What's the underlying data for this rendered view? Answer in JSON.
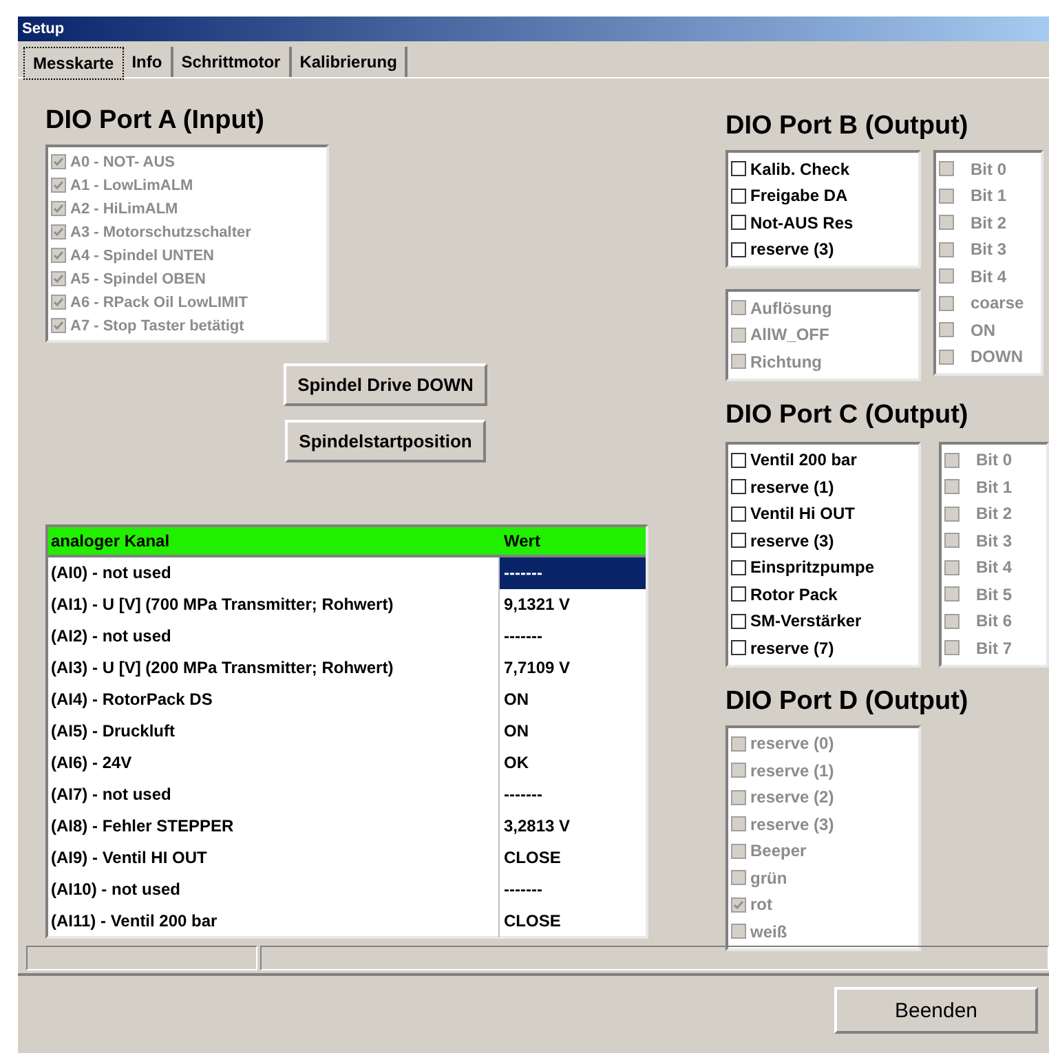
{
  "window": {
    "title": "Setup"
  },
  "tabs": [
    {
      "label": "Messkarte",
      "selected": true
    },
    {
      "label": "Info",
      "selected": false
    },
    {
      "label": "Schrittmotor",
      "selected": false
    },
    {
      "label": "Kalibrierung",
      "selected": false
    }
  ],
  "port_a": {
    "title": "DIO Port A (Input)",
    "items": [
      {
        "label": "A0 - NOT- AUS",
        "checked": true,
        "disabled": true
      },
      {
        "label": "A1 - LowLimALM",
        "checked": true,
        "disabled": true
      },
      {
        "label": "A2 - HiLimALM",
        "checked": true,
        "disabled": true
      },
      {
        "label": "A3 - Motorschutzschalter",
        "checked": true,
        "disabled": true
      },
      {
        "label": "A4 - Spindel UNTEN",
        "checked": true,
        "disabled": true
      },
      {
        "label": "A5 - Spindel OBEN",
        "checked": true,
        "disabled": true
      },
      {
        "label": "A6 - RPack Oil LowLIMIT",
        "checked": true,
        "disabled": true
      },
      {
        "label": "A7 - Stop Taster betätigt",
        "checked": true,
        "disabled": true
      }
    ]
  },
  "buttons": [
    "Spindel Drive DOWN",
    "Spindelstartposition"
  ],
  "table": {
    "columns": [
      "analoger Kanal",
      "Wert"
    ],
    "rows": [
      {
        "cells": [
          "(AI0) - not used",
          "-------"
        ],
        "selected": true
      },
      {
        "cells": [
          "(AI1) - U [V] (700 MPa Transmitter; Rohwert)",
          "9,1321 V"
        ],
        "selected": false
      },
      {
        "cells": [
          "(AI2) - not used",
          "-------"
        ],
        "selected": false
      },
      {
        "cells": [
          "(AI3) - U [V] (200 MPa Transmitter; Rohwert)",
          "7,7109 V"
        ],
        "selected": false
      },
      {
        "cells": [
          "(AI4) - RotorPack DS",
          "ON"
        ],
        "selected": false
      },
      {
        "cells": [
          "(AI5) - Druckluft",
          "ON"
        ],
        "selected": false
      },
      {
        "cells": [
          "(AI6) - 24V",
          "OK"
        ],
        "selected": false
      },
      {
        "cells": [
          "(AI7) - not used",
          "-------"
        ],
        "selected": false
      },
      {
        "cells": [
          "(AI8) - Fehler STEPPER",
          "3,2813 V"
        ],
        "selected": false
      },
      {
        "cells": [
          "(AI9) - Ventil HI OUT",
          "CLOSE"
        ],
        "selected": false
      },
      {
        "cells": [
          "(AI10) - not used",
          "-------"
        ],
        "selected": false
      },
      {
        "cells": [
          "(AI11) - Ventil 200 bar",
          "CLOSE"
        ],
        "selected": false
      }
    ]
  },
  "port_b": {
    "title": "DIO Port B (Output)",
    "outputs": [
      {
        "label": "Kalib. Check",
        "checked": false,
        "disabled": false
      },
      {
        "label": "Freigabe DA",
        "checked": false,
        "disabled": false
      },
      {
        "label": "Not-AUS Res",
        "checked": false,
        "disabled": false
      },
      {
        "label": "reserve (3)",
        "checked": false,
        "disabled": false
      }
    ],
    "settings": [
      {
        "label": "Auflösung",
        "checked": false,
        "disabled": true
      },
      {
        "label": "AllW_OFF",
        "checked": false,
        "disabled": true
      },
      {
        "label": "Richtung",
        "checked": false,
        "disabled": true
      }
    ],
    "bits": [
      {
        "label": "Bit 0",
        "checked": false,
        "disabled": true
      },
      {
        "label": "Bit 1",
        "checked": false,
        "disabled": true
      },
      {
        "label": "Bit 2",
        "checked": false,
        "disabled": true
      },
      {
        "label": "Bit 3",
        "checked": false,
        "disabled": true
      },
      {
        "label": "Bit 4",
        "checked": false,
        "disabled": true
      },
      {
        "label": "coarse",
        "checked": false,
        "disabled": true
      },
      {
        "label": "ON",
        "checked": false,
        "disabled": true
      },
      {
        "label": "DOWN",
        "checked": false,
        "disabled": true
      }
    ]
  },
  "port_c": {
    "title": "DIO Port C (Output)",
    "outputs": [
      {
        "label": "Ventil 200 bar",
        "checked": false,
        "disabled": false
      },
      {
        "label": "reserve (1)",
        "checked": false,
        "disabled": false
      },
      {
        "label": "Ventil Hi OUT",
        "checked": false,
        "disabled": false
      },
      {
        "label": "reserve (3)",
        "checked": false,
        "disabled": false
      },
      {
        "label": "Einspritzpumpe",
        "checked": false,
        "disabled": false
      },
      {
        "label": "Rotor Pack",
        "checked": false,
        "disabled": false
      },
      {
        "label": "SM-Verstärker",
        "checked": false,
        "disabled": false
      },
      {
        "label": "reserve (7)",
        "checked": false,
        "disabled": false
      }
    ],
    "bits": [
      {
        "label": "Bit 0",
        "checked": false,
        "disabled": true
      },
      {
        "label": "Bit 1",
        "checked": false,
        "disabled": true
      },
      {
        "label": "Bit 2",
        "checked": false,
        "disabled": true
      },
      {
        "label": "Bit 3",
        "checked": false,
        "disabled": true
      },
      {
        "label": "Bit 4",
        "checked": false,
        "disabled": true
      },
      {
        "label": "Bit 5",
        "checked": false,
        "disabled": true
      },
      {
        "label": "Bit 6",
        "checked": false,
        "disabled": true
      },
      {
        "label": "Bit 7",
        "checked": false,
        "disabled": true
      }
    ]
  },
  "port_d": {
    "title": "DIO Port D (Output)",
    "items": [
      {
        "label": "reserve (0)",
        "checked": false,
        "disabled": true
      },
      {
        "label": "reserve (1)",
        "checked": false,
        "disabled": true
      },
      {
        "label": "reserve (2)",
        "checked": false,
        "disabled": true
      },
      {
        "label": "reserve (3)",
        "checked": false,
        "disabled": true
      },
      {
        "label": "Beeper",
        "checked": false,
        "disabled": true
      },
      {
        "label": "grün",
        "checked": false,
        "disabled": true
      },
      {
        "label": "rot",
        "checked": true,
        "disabled": true
      },
      {
        "label": "weiß",
        "checked": false,
        "disabled": true
      }
    ]
  },
  "close_button": "Beenden"
}
